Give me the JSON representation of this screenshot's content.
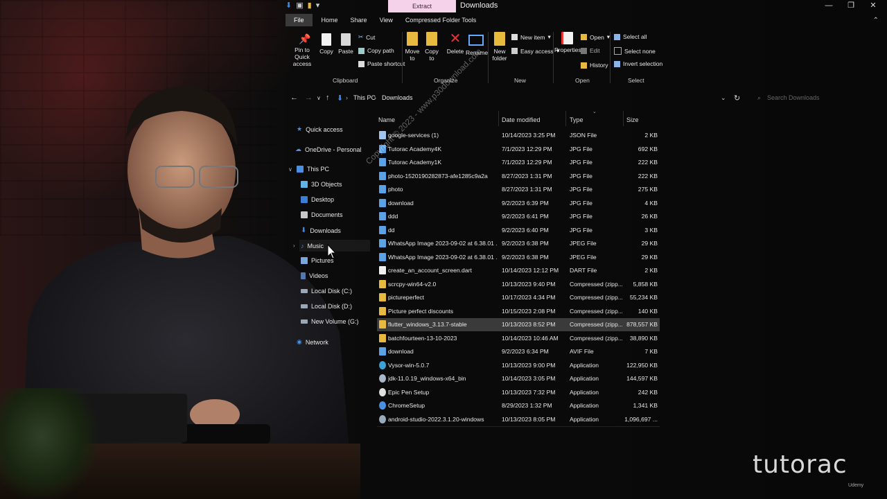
{
  "window": {
    "title": "Downloads",
    "contextual_tab": "Extract",
    "controls": [
      "—",
      "❐",
      "✕"
    ]
  },
  "ribbon_tabs": [
    "File",
    "Home",
    "Share",
    "View",
    "Compressed Folder Tools"
  ],
  "ribbon": {
    "clipboard": {
      "pin": "Pin to Quick access",
      "copy": "Copy",
      "paste": "Paste",
      "cut": "Cut",
      "copy_path": "Copy path",
      "paste_shortcut": "Paste shortcut",
      "group": "Clipboard"
    },
    "organize": {
      "move_to": "Move to",
      "copy_to": "Copy to",
      "delete": "Delete",
      "rename": "Rename",
      "group": "Organize"
    },
    "new": {
      "new_folder": "New folder",
      "new_item": "New item",
      "easy_access": "Easy access",
      "group": "New"
    },
    "open": {
      "properties": "Properties",
      "open": "Open",
      "edit": "Edit",
      "history": "History",
      "group": "Open"
    },
    "select": {
      "select_all": "Select all",
      "select_none": "Select none",
      "invert": "Invert selection",
      "group": "Select"
    }
  },
  "address": {
    "crumbs": [
      "This PC",
      "Downloads"
    ],
    "search_placeholder": "Search Downloads"
  },
  "nav": {
    "quick_access": "Quick access",
    "onedrive": "OneDrive - Personal",
    "this_pc": "This PC",
    "items": [
      "3D Objects",
      "Desktop",
      "Documents",
      "Downloads",
      "Music",
      "Pictures",
      "Videos",
      "Local Disk (C:)",
      "Local Disk (D:)",
      "New Volume (G:)"
    ],
    "network": "Network"
  },
  "columns": {
    "name": "Name",
    "date": "Date modified",
    "type": "Type",
    "size": "Size"
  },
  "files": [
    {
      "name": "google-services (1)",
      "date": "10/14/2023 3:25 PM",
      "type": "JSON File",
      "size": "2 KB",
      "icon": "json",
      "color": "#9fc4ef"
    },
    {
      "name": "Tutorac Academy4K",
      "date": "7/1/2023 12:29 PM",
      "type": "JPG File",
      "size": "692 KB",
      "icon": "image",
      "color": "#5aa1e6"
    },
    {
      "name": "Tutorac Academy1K",
      "date": "7/1/2023 12:29 PM",
      "type": "JPG File",
      "size": "222 KB",
      "icon": "image",
      "color": "#5aa1e6"
    },
    {
      "name": "photo-1520190282873-afe1285c9a2a",
      "date": "8/27/2023 1:31 PM",
      "type": "JPG File",
      "size": "222 KB",
      "icon": "image",
      "color": "#5aa1e6"
    },
    {
      "name": "photo",
      "date": "8/27/2023 1:31 PM",
      "type": "JPG File",
      "size": "275 KB",
      "icon": "image",
      "color": "#5aa1e6"
    },
    {
      "name": "download",
      "date": "9/2/2023 6:39 PM",
      "type": "JPG File",
      "size": "4 KB",
      "icon": "image",
      "color": "#5aa1e6"
    },
    {
      "name": "ddd",
      "date": "9/2/2023 6:41 PM",
      "type": "JPG File",
      "size": "26 KB",
      "icon": "image",
      "color": "#5aa1e6"
    },
    {
      "name": "dd",
      "date": "9/2/2023 6:40 PM",
      "type": "JPG File",
      "size": "3 KB",
      "icon": "image",
      "color": "#5aa1e6"
    },
    {
      "name": "WhatsApp Image 2023-09-02 at 6.38.01 ...",
      "date": "9/2/2023 6:38 PM",
      "type": "JPEG File",
      "size": "29 KB",
      "icon": "image",
      "color": "#5aa1e6"
    },
    {
      "name": "WhatsApp Image 2023-09-02 at 6.38.01 ...",
      "date": "9/2/2023 6:38 PM",
      "type": "JPEG File",
      "size": "29 KB",
      "icon": "image",
      "color": "#5aa1e6"
    },
    {
      "name": "create_an_account_screen.dart",
      "date": "10/14/2023 12:12 PM",
      "type": "DART File",
      "size": "2 KB",
      "icon": "document",
      "color": "#f0f0f0"
    },
    {
      "name": "scrcpy-win64-v2.0",
      "date": "10/13/2023 9:40 PM",
      "type": "Compressed (zipp...",
      "size": "5,858 KB",
      "icon": "zip-folder",
      "color": "#e7b93e"
    },
    {
      "name": "pictureperfect",
      "date": "10/17/2023 4:34 PM",
      "type": "Compressed (zipp...",
      "size": "55,234 KB",
      "icon": "zip-folder",
      "color": "#e7b93e"
    },
    {
      "name": "Picture perfect discounts",
      "date": "10/15/2023 2:08 PM",
      "type": "Compressed (zipp...",
      "size": "140 KB",
      "icon": "zip-folder",
      "color": "#e7b93e"
    },
    {
      "name": "flutter_windows_3.13.7-stable",
      "date": "10/13/2023 8:52 PM",
      "type": "Compressed (zipp...",
      "size": "878,557 KB",
      "icon": "zip-folder",
      "color": "#e7b93e",
      "selected": true
    },
    {
      "name": "batchfourteen-13-10-2023",
      "date": "10/14/2023 10:46 AM",
      "type": "Compressed (zipp...",
      "size": "38,890 KB",
      "icon": "zip-folder",
      "color": "#e7b93e"
    },
    {
      "name": "download",
      "date": "9/2/2023 6:34 PM",
      "type": "AVIF File",
      "size": "7 KB",
      "icon": "image",
      "color": "#5aa1e6"
    },
    {
      "name": "Vysor-win-5.0.7",
      "date": "10/13/2023 9:00 PM",
      "type": "Application",
      "size": "122,950 KB",
      "icon": "app",
      "color": "#3fa0d8"
    },
    {
      "name": "jdk-11.0.19_windows-x64_bin",
      "date": "10/14/2023 3:05 PM",
      "type": "Application",
      "size": "144,597 KB",
      "icon": "app",
      "color": "#a8b8c8"
    },
    {
      "name": "Epic Pen Setup",
      "date": "10/13/2023 7:32 PM",
      "type": "Application",
      "size": "242 KB",
      "icon": "app",
      "color": "#e0e0e0"
    },
    {
      "name": "ChromeSetup",
      "date": "8/29/2023 1:32 PM",
      "type": "Application",
      "size": "1,341 KB",
      "icon": "app",
      "color": "#4a90e2"
    },
    {
      "name": "android-studio-2022.3.1.20-windows",
      "date": "10/13/2023 8:05 PM",
      "type": "Application",
      "size": "1,096,697 ...",
      "icon": "app",
      "color": "#9ab"
    }
  ],
  "watermark": "Copyright © 2023 - www.p30download.com",
  "brand": "tutorac",
  "brand_sub": "Udemy"
}
